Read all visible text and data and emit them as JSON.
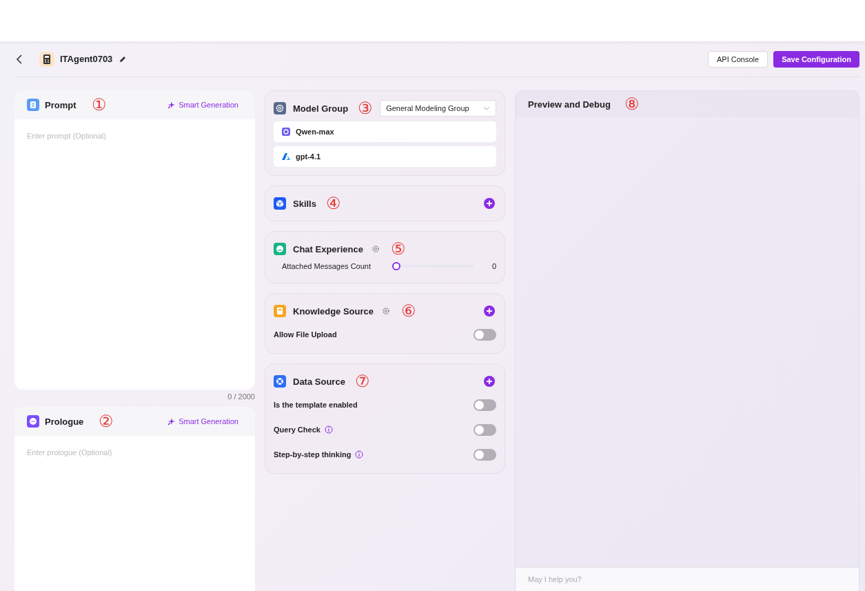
{
  "header": {
    "agent_name": "ITAgent0703",
    "buttons": [
      {
        "label": "API Console",
        "kind": "secondary"
      },
      {
        "label": "Save Configuration",
        "kind": "primary"
      }
    ]
  },
  "left_panels": [
    {
      "kind": "prompt",
      "title": "Prompt",
      "annotation": "①",
      "action": "Smart Generation",
      "placeholder": "Enter prompt (Optional)",
      "counter": "0 / 2000"
    },
    {
      "kind": "prologue",
      "title": "Prologue",
      "annotation": "②",
      "action": "Smart Generation",
      "placeholder": "Enter prologue (Optional)"
    }
  ],
  "middle_cards": [
    {
      "kind": "model",
      "title": "Model Group",
      "annotation": "③",
      "settings": false,
      "add": false,
      "select": "General Modeling Group",
      "models": [
        {
          "name": "Qwen-max",
          "kind": "qwen"
        },
        {
          "name": "gpt-4.1",
          "kind": "azure"
        }
      ]
    },
    {
      "kind": "skills",
      "title": "Skills",
      "annotation": "④",
      "settings": false,
      "add": true
    },
    {
      "kind": "chat",
      "title": "Chat Experience",
      "annotation": "⑤",
      "settings": true,
      "add": false,
      "slider": {
        "label": "Attached Messages Count",
        "level": 0,
        "reading": "0"
      }
    },
    {
      "kind": "knowledge",
      "title": "Knowledge Source",
      "annotation": "⑥",
      "settings": true,
      "add": true,
      "toggles": [
        {
          "label": "Allow File Upload",
          "on": false,
          "info": false
        }
      ]
    },
    {
      "kind": "data",
      "title": "Data Source",
      "annotation": "⑦",
      "settings": false,
      "add": true,
      "toggles": [
        {
          "label": "Is the template enabled",
          "on": false,
          "info": false
        },
        {
          "label": "Query Check",
          "on": false,
          "info": true
        },
        {
          "label": "Step-by-step thinking",
          "on": false,
          "info": true
        }
      ]
    }
  ],
  "preview": {
    "title": "Preview and Debug",
    "annotation": "⑧",
    "placeholder": "May I help you?"
  }
}
